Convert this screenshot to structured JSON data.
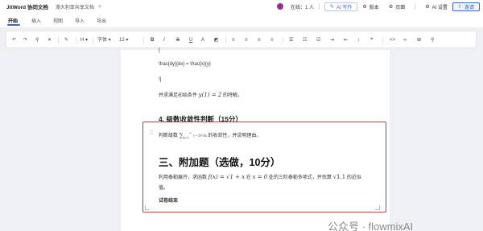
{
  "titlebar": {
    "app_name": "JitWord 协同文档",
    "document_title": "澳大利亚共享文档",
    "new_tab": "+",
    "online_status": "在线：1 人",
    "ai_write_label": "AI 写作",
    "version_label": "版本",
    "page_label": "页面",
    "ai_settings_label": "AI 设置",
    "share_label": "邀请"
  },
  "menu": {
    "tabs": [
      "开始",
      "插入",
      "视图",
      "导入",
      "导出"
    ],
    "active_tab": "开始"
  },
  "toolbar": {
    "style_label": "字体",
    "font_size": "12",
    "heading_label": "H"
  },
  "document": {
    "brace_open": "{",
    "latex_line": "\\frac{dy}{dx} = \\frac{x}{y}",
    "latex_close": "\\]",
    "condition_line": {
      "prefix": "并求满足初始条件 ",
      "math": "y(1) = 2",
      "suffix": " 的特解。"
    },
    "section4_title": "4. 级数收敛性判断（15分）",
    "series_line": {
      "prefix": "判断级数 ",
      "suffix": " 的收敛性，并说明理由。"
    },
    "section3_title": "三、附加题（选做，10分）",
    "extra_line1": {
      "part_a": "利用泰勒展开，求函数 ",
      "math_a": "f(x) = √1 + x",
      "part_b": " 在 ",
      "math_b": "x = 0",
      "part_c": " 处的三阶泰勒多项式，并估算 ",
      "math_c": "√1.1",
      "part_d": " 的近似"
    },
    "extra_line2": "值。",
    "end_text": "试卷结束"
  },
  "watermark": "公众号 · flowmixAI",
  "colors": {
    "accent": "#3c64c9",
    "selection_border": "#d32f2f",
    "avatar": "#9b2d8f"
  }
}
